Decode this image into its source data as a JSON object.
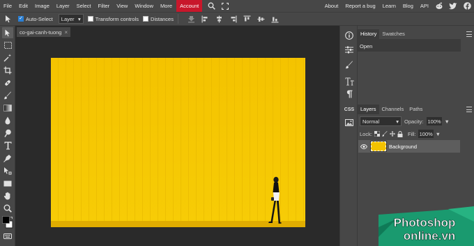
{
  "menu": {
    "items": [
      "File",
      "Edit",
      "Image",
      "Layer",
      "Select",
      "Filter",
      "View",
      "Window",
      "More"
    ],
    "account": "Account",
    "right_items": [
      "About",
      "Report a bug",
      "Learn",
      "Blog",
      "API"
    ],
    "account_color": "#c8172b"
  },
  "options": {
    "auto_select_label": "Auto-Select",
    "auto_select_checked": true,
    "target_value": "Layer",
    "transform_label": "Transform controls",
    "distances_label": "Distances"
  },
  "document": {
    "tab_name": "co-gai-canh-tuong",
    "tab_close": "×",
    "canvas_color": "#f3c200"
  },
  "icon_column": {
    "items": [
      "info-icon",
      "sliders-icon",
      "brush-settings-icon",
      "character-icon",
      "paragraph-icon",
      "css-icon",
      "image-icon"
    ],
    "css_label": "CSS"
  },
  "history_panel": {
    "tabs": [
      "History",
      "Swatches"
    ],
    "active_tab": "History",
    "items": [
      "Open"
    ]
  },
  "layers_panel": {
    "tabs": [
      "Layers",
      "Channels",
      "Paths"
    ],
    "active_tab": "Layers",
    "blend_mode": "Normal",
    "opacity_label": "Opacity:",
    "opacity_value": "100%",
    "lock_label": "Lock:",
    "fill_label": "Fill:",
    "fill_value": "100%",
    "layers": [
      {
        "name": "Background",
        "visible": true
      }
    ]
  },
  "logo": {
    "line1": "Photoshop",
    "line2": "online.vn"
  }
}
